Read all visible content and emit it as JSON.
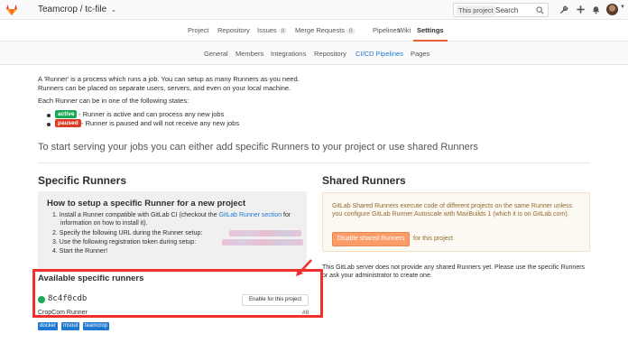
{
  "topbar": {
    "group": "Teamcrop",
    "separator": "/",
    "project": "tc-file",
    "caret": "⌄",
    "search_scope": "This project",
    "search_placeholder": "Search",
    "icons": [
      "gitlab-logo",
      "search-icon",
      "wrench-icon",
      "plus-icon",
      "bell-icon",
      "avatar"
    ]
  },
  "project_tabs": [
    {
      "label": "Project"
    },
    {
      "label": "Repository"
    },
    {
      "label": "Issues",
      "count": "0"
    },
    {
      "label": "Merge Requests",
      "count": "0"
    },
    {
      "label": "Pipelines"
    },
    {
      "label": "Wiki"
    },
    {
      "label": "Settings",
      "active": true
    }
  ],
  "settings_tabs": [
    {
      "label": "General"
    },
    {
      "label": "Members"
    },
    {
      "label": "Integrations"
    },
    {
      "label": "Repository"
    },
    {
      "label": "CI/CD Pipelines",
      "active": true
    },
    {
      "label": "Pages"
    }
  ],
  "intro": {
    "line1": "A 'Runner' is a process which runs a job. You can setup as many Runners as you need.",
    "line2": "Runners can be placed on separate users, servers, and even on your local machine.",
    "line3": "Each Runner can be in one of the following states:",
    "active_badge": "active",
    "active_text": "- Runner is active and can process any new jobs",
    "paused_badge": "paused",
    "paused_text": "- Runner is paused and will not receive any new jobs"
  },
  "lead": "To start serving your jobs you can either add specific Runners to your project or use shared Runners",
  "specific": {
    "title": "Specific Runners",
    "howto_title": "How to setup a specific Runner for a new project",
    "step1a": "1. Install a Runner compatible with GitLab CI (checkout the ",
    "step1_link": "GitLab Runner section",
    "step1b": " for",
    "step1c": "information on how to install it).",
    "step2": "2. Specify the following URL during the Runner setup:",
    "step3": "3. Use the following registration token during setup:",
    "step4": "4. Start the Runner!",
    "available_title": "Available specific runners",
    "runner_token": "8c4f0cdb",
    "enable_button": "Enable for this project",
    "runner_description": "CropCom Runner",
    "runner_id": "#8",
    "tags": [
      "docker",
      "msout",
      "teamcrop"
    ]
  },
  "shared": {
    "title": "Shared Runners",
    "line1": "GitLab Shared Runners execute code of different projects on the same Runner unless",
    "line2": "you configure GitLab Runner Autoscale with MaxBuilds 1 (which it is on GitLab.com).",
    "disable_button": "Disable shared Runners",
    "for_project": "for this project",
    "none1": "This GitLab server does not provide any shared Runners yet. Please use the specific Runners",
    "none2": "or ask your administrator to create one."
  },
  "colors": {
    "accent_orange": "#e75e40",
    "link_blue": "#1f78d1",
    "active_green": "#1aaa55",
    "paused_red": "#db3b21",
    "annotation_red": "#f0302a"
  }
}
